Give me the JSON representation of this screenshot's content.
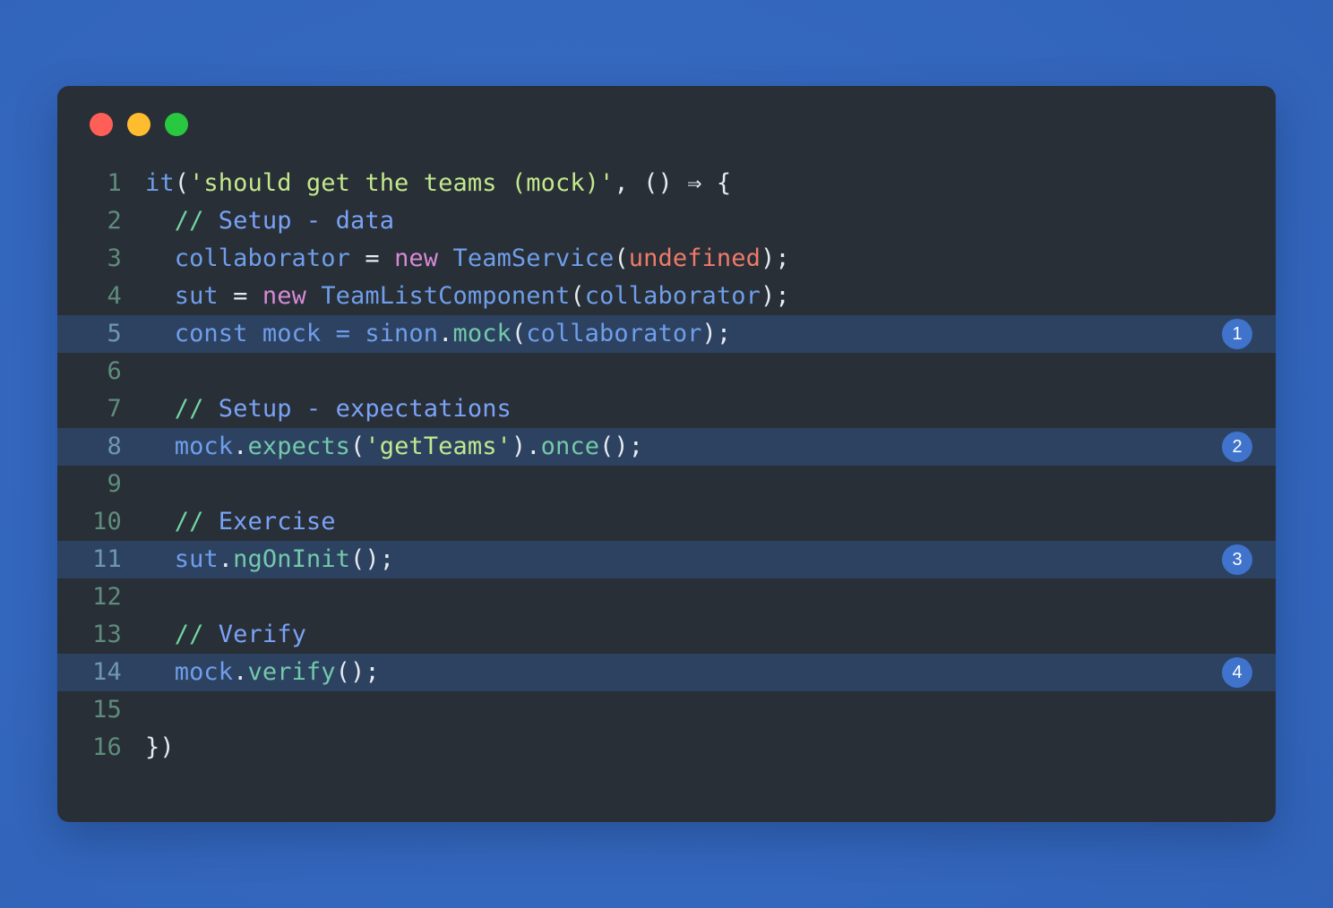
{
  "window": {
    "title": "",
    "controls": [
      {
        "name": "close",
        "color": "#ff5f56",
        "label": "Close"
      },
      {
        "name": "minimize",
        "color": "#febc2e",
        "label": "Minimize"
      },
      {
        "name": "zoom",
        "color": "#28c840",
        "label": "Zoom"
      }
    ]
  },
  "theme": {
    "backdrop": "#3367bf",
    "editor_bg": "#282f36",
    "highlight_bg": "#2d4261",
    "badge_bg": "#3f73cc",
    "badge_fg": "#ffffff",
    "lineno_fg": "#5f8c7c",
    "string": "#c3e88d",
    "keyword": "#d58ad6",
    "identifier": "#6f9eeb",
    "method": "#73c9a9",
    "constant": "#f07a6a",
    "comment_slash": "#73d4a2",
    "comment_text": "#7aa2f7",
    "punctuation": "#e6ebf0"
  },
  "editor": {
    "language": "javascript",
    "lines": [
      {
        "number": "1",
        "highlighted": false,
        "badge": null,
        "text": "it('should get the teams (mock)', () ⇒ {",
        "tokens": [
          {
            "t": "ident",
            "v": "it"
          },
          {
            "t": "punct",
            "v": "("
          },
          {
            "t": "string",
            "v": "'should get the teams (mock)'"
          },
          {
            "t": "punct",
            "v": ", () ⇒ {"
          }
        ]
      },
      {
        "number": "2",
        "highlighted": false,
        "badge": null,
        "text": "  // Setup - data",
        "tokens": [
          {
            "t": "plain",
            "v": "  "
          },
          {
            "t": "comment-slash",
            "v": "//"
          },
          {
            "t": "comment-text",
            "v": " Setup - data"
          }
        ]
      },
      {
        "number": "3",
        "highlighted": false,
        "badge": null,
        "text": "  collaborator = new TeamService(undefined);",
        "tokens": [
          {
            "t": "plain",
            "v": "  "
          },
          {
            "t": "ident",
            "v": "collaborator"
          },
          {
            "t": "punct",
            "v": " = "
          },
          {
            "t": "keyword",
            "v": "new"
          },
          {
            "t": "plain",
            "v": " "
          },
          {
            "t": "ident",
            "v": "TeamService"
          },
          {
            "t": "punct",
            "v": "("
          },
          {
            "t": "const",
            "v": "undefined"
          },
          {
            "t": "punct",
            "v": ");"
          }
        ]
      },
      {
        "number": "4",
        "highlighted": false,
        "badge": null,
        "text": "  sut = new TeamListComponent(collaborator);",
        "tokens": [
          {
            "t": "plain",
            "v": "  "
          },
          {
            "t": "ident",
            "v": "sut"
          },
          {
            "t": "punct",
            "v": " = "
          },
          {
            "t": "keyword",
            "v": "new"
          },
          {
            "t": "plain",
            "v": " "
          },
          {
            "t": "ident",
            "v": "TeamListComponent"
          },
          {
            "t": "punct",
            "v": "("
          },
          {
            "t": "ident",
            "v": "collaborator"
          },
          {
            "t": "punct",
            "v": ");"
          }
        ]
      },
      {
        "number": "5",
        "highlighted": true,
        "badge": "1",
        "text": "  const mock = sinon.mock(collaborator);",
        "tokens": [
          {
            "t": "plain",
            "v": "  "
          },
          {
            "t": "ident",
            "v": "const mock = sinon"
          },
          {
            "t": "punct",
            "v": "."
          },
          {
            "t": "method",
            "v": "mock"
          },
          {
            "t": "punct",
            "v": "("
          },
          {
            "t": "ident",
            "v": "collaborator"
          },
          {
            "t": "punct",
            "v": ");"
          }
        ]
      },
      {
        "number": "6",
        "highlighted": false,
        "badge": null,
        "text": "",
        "tokens": []
      },
      {
        "number": "7",
        "highlighted": false,
        "badge": null,
        "text": "  // Setup - expectations",
        "tokens": [
          {
            "t": "plain",
            "v": "  "
          },
          {
            "t": "comment-slash",
            "v": "//"
          },
          {
            "t": "comment-text",
            "v": " Setup - expectations"
          }
        ]
      },
      {
        "number": "8",
        "highlighted": true,
        "badge": "2",
        "text": "  mock.expects('getTeams').once();",
        "tokens": [
          {
            "t": "plain",
            "v": "  "
          },
          {
            "t": "ident",
            "v": "mock"
          },
          {
            "t": "punct",
            "v": "."
          },
          {
            "t": "method",
            "v": "expects"
          },
          {
            "t": "punct",
            "v": "("
          },
          {
            "t": "string",
            "v": "'getTeams'"
          },
          {
            "t": "punct",
            "v": ")."
          },
          {
            "t": "method",
            "v": "once"
          },
          {
            "t": "punct",
            "v": "();"
          }
        ]
      },
      {
        "number": "9",
        "highlighted": false,
        "badge": null,
        "text": "",
        "tokens": []
      },
      {
        "number": "10",
        "highlighted": false,
        "badge": null,
        "text": "  // Exercise",
        "tokens": [
          {
            "t": "plain",
            "v": "  "
          },
          {
            "t": "comment-slash",
            "v": "//"
          },
          {
            "t": "comment-text",
            "v": " Exercise"
          }
        ]
      },
      {
        "number": "11",
        "highlighted": true,
        "badge": "3",
        "text": "  sut.ngOnInit();",
        "tokens": [
          {
            "t": "plain",
            "v": "  "
          },
          {
            "t": "ident",
            "v": "sut"
          },
          {
            "t": "punct",
            "v": "."
          },
          {
            "t": "method",
            "v": "ngOnInit"
          },
          {
            "t": "punct",
            "v": "();"
          }
        ]
      },
      {
        "number": "12",
        "highlighted": false,
        "badge": null,
        "text": "",
        "tokens": []
      },
      {
        "number": "13",
        "highlighted": false,
        "badge": null,
        "text": "  // Verify",
        "tokens": [
          {
            "t": "plain",
            "v": "  "
          },
          {
            "t": "comment-slash",
            "v": "//"
          },
          {
            "t": "comment-text",
            "v": " Verify"
          }
        ]
      },
      {
        "number": "14",
        "highlighted": true,
        "badge": "4",
        "text": "  mock.verify();",
        "tokens": [
          {
            "t": "plain",
            "v": "  "
          },
          {
            "t": "ident",
            "v": "mock"
          },
          {
            "t": "punct",
            "v": "."
          },
          {
            "t": "method",
            "v": "verify"
          },
          {
            "t": "punct",
            "v": "();"
          }
        ]
      },
      {
        "number": "15",
        "highlighted": false,
        "badge": null,
        "text": "",
        "tokens": []
      },
      {
        "number": "16",
        "highlighted": false,
        "badge": null,
        "text": "})",
        "tokens": [
          {
            "t": "punct",
            "v": "})"
          }
        ]
      }
    ]
  }
}
